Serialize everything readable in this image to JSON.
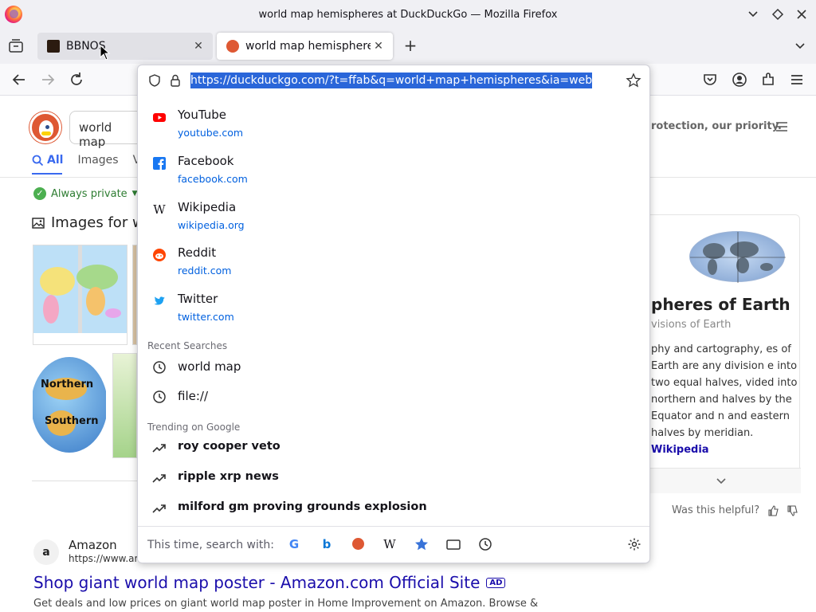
{
  "window": {
    "title": "world map hemispheres at DuckDuckGo — Mozilla Firefox"
  },
  "tabs": [
    {
      "label": "BBNOS",
      "active": false
    },
    {
      "label": "world map hemispheres",
      "active": true
    }
  ],
  "urlbar": {
    "url": "https://duckduckgo.com/?t=ffab&q=world+map+hemispheres&ia=web"
  },
  "suggestions": [
    {
      "title": "YouTube",
      "url": "youtube.com",
      "icon": "youtube-icon"
    },
    {
      "title": "Facebook",
      "url": "facebook.com",
      "icon": "facebook-icon"
    },
    {
      "title": "Wikipedia",
      "url": "wikipedia.org",
      "icon": "wikipedia-icon"
    },
    {
      "title": "Reddit",
      "url": "reddit.com",
      "icon": "reddit-icon"
    },
    {
      "title": "Twitter",
      "url": "twitter.com",
      "icon": "twitter-icon"
    }
  ],
  "recent": {
    "label": "Recent Searches",
    "items": [
      "world map",
      "file://"
    ]
  },
  "trending": {
    "label": "Trending on Google",
    "items": [
      "roy cooper veto",
      "ripple xrp news",
      "milford gm proving grounds explosion"
    ]
  },
  "search_with": {
    "label": "This time, search with:",
    "engines": [
      "Google",
      "Bing",
      "DuckDuckGo",
      "Wikipedia",
      "Bookmarks",
      "Tabs",
      "History"
    ]
  },
  "page": {
    "search_query": "world map",
    "tabs": [
      "All",
      "Images",
      "Vi"
    ],
    "always_private": "Always private",
    "images_heading": "Images for w",
    "protection_text": "rotection, our priority.",
    "knowledge_panel": {
      "title": "pheres of Earth",
      "subtitle": "visions of Earth",
      "description": "phy and cartography, es of Earth are any division e into two equal halves, vided into northern and halves by the Equator and n and eastern halves by meridian.",
      "link": "Wikipedia"
    },
    "helpful": "Was this helpful?",
    "result": {
      "favicon_letter": "a",
      "site": "Amazon",
      "url": "https://www.ar",
      "title": "Shop giant world map poster - Amazon.com Official Site",
      "ad": "AD",
      "snippet": "Get deals and low prices on giant world map poster in Home Improvement on Amazon. Browse &"
    },
    "map_labels": {
      "northern": "Northern",
      "southern": "Southern"
    }
  },
  "colors": {
    "accent": "#0060df",
    "selection": "#2a66d9",
    "ddg_orange": "#de5833",
    "link": "#1a0dab"
  }
}
